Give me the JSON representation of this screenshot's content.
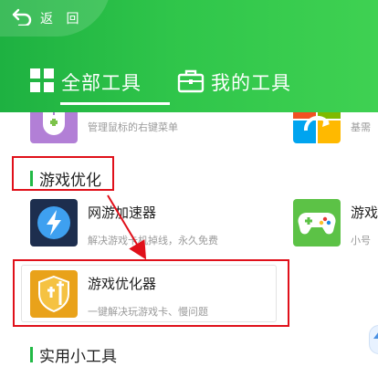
{
  "header": {
    "back_label": "返 回",
    "tabs": [
      {
        "label": "全部工具",
        "selected": true
      },
      {
        "label": "我的工具",
        "selected": false
      }
    ]
  },
  "tools_top": [
    {
      "title": "",
      "desc": "管理鼠标的右键菜单",
      "icon": "mouse-icon"
    },
    {
      "title": "",
      "desc": "基需",
      "icon": "windows-refresh-icon"
    }
  ],
  "sections": [
    {
      "title": "游戏优化",
      "tools": [
        {
          "title": "网游加速器",
          "desc": "解决游戏卡机掉线，永久免费",
          "icon": "lightning-icon"
        },
        {
          "title": "游戏",
          "desc": "小号",
          "icon": "gamepad-icon"
        },
        {
          "title": "游戏优化器",
          "desc": "一键解决玩游戏卡、慢问题",
          "icon": "shield-sword-icon",
          "highlighted": true
        }
      ]
    },
    {
      "title": "实用小工具",
      "tools": []
    }
  ],
  "colors": {
    "header_green": "#2fc54a",
    "accent_green": "#21b945",
    "annotation_red": "#e0101a"
  }
}
